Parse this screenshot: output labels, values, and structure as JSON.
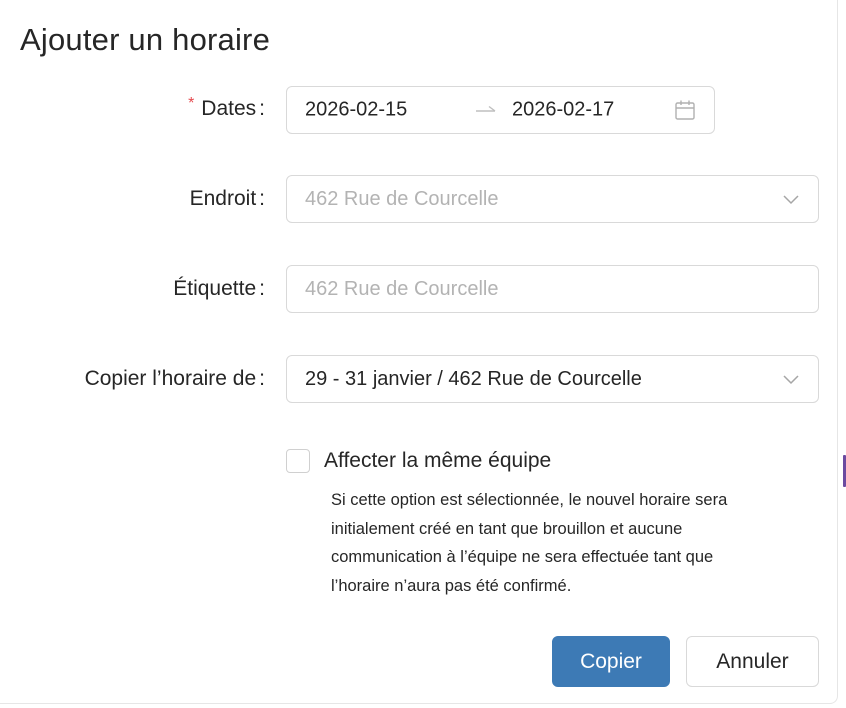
{
  "dialog": {
    "title": "Ajouter un horaire"
  },
  "form": {
    "dates": {
      "required_mark": "*",
      "label": "Dates",
      "colon": ":",
      "start": "2026-02-15",
      "end": "2026-02-17",
      "icon": "calendar-icon"
    },
    "location": {
      "label": "Endroit",
      "colon": ":",
      "placeholder": "462 Rue de Courcelle",
      "icon": "chevron-down-icon"
    },
    "tag": {
      "label": "Étiquette",
      "colon": ":",
      "placeholder": "462 Rue de Courcelle"
    },
    "copy_from": {
      "label": "Copier l’horaire de",
      "colon": ":",
      "value": "29 - 31 janvier / 462 Rue de Courcelle",
      "icon": "chevron-down-icon"
    },
    "same_team": {
      "label": "Affecter la même équipe",
      "checked": false,
      "help_lines": [
        "Si cette option est sélectionnée, le nouvel horaire sera",
        "initialement créé en tant que brouillon et aucune",
        "communication à l’équipe ne sera effectuée tant que",
        "l’horaire n’aura pas été confirmé."
      ]
    }
  },
  "actions": {
    "copy_label": "Copier",
    "cancel_label": "Annuler"
  },
  "colors": {
    "primary": "#3d7ab5",
    "required": "#e5484d",
    "placeholder": "#b3b3b3",
    "border": "#d9d9d9"
  }
}
